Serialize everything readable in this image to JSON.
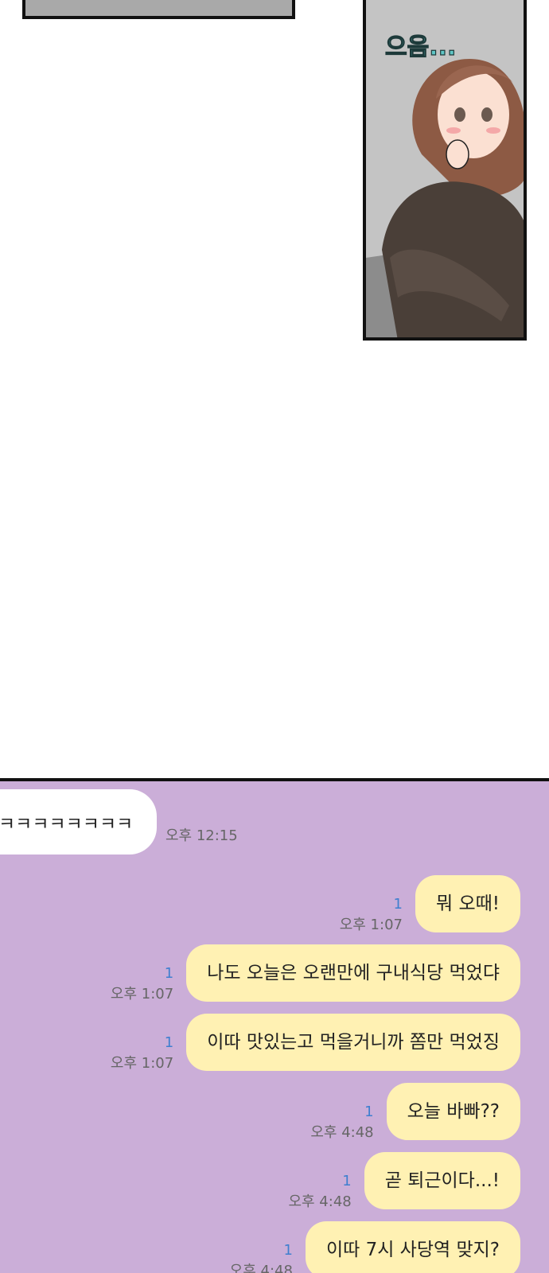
{
  "comic": {
    "sfx_text": "으음..."
  },
  "chat": {
    "incoming": {
      "text": "ㅋㅋㅋㅋㅋㅋㅋㅋ",
      "time": "오후 12:15"
    },
    "outgoing": [
      {
        "read": "1",
        "time": "오후 1:07",
        "text": "뭐 오때!"
      },
      {
        "read": "1",
        "time": "오후 1:07",
        "text": "나도 오늘은 오랜만에 구내식당 먹었댜"
      },
      {
        "read": "1",
        "time": "오후 1:07",
        "text": "이따 맛있는고 먹을거니까 쫌만 먹었징"
      },
      {
        "read": "1",
        "time": "오후 4:48",
        "text": "오늘 바빠??"
      },
      {
        "read": "1",
        "time": "오후 4:48",
        "text": "곧 퇴근이다...!"
      },
      {
        "read": "1",
        "time": "오후 4:48",
        "text": "이따 7시 사당역 맞지?"
      }
    ]
  },
  "colors": {
    "chat_bg": "#cbaed8",
    "my_bubble": "#fff1b3",
    "read_count": "#3f7fcf"
  }
}
